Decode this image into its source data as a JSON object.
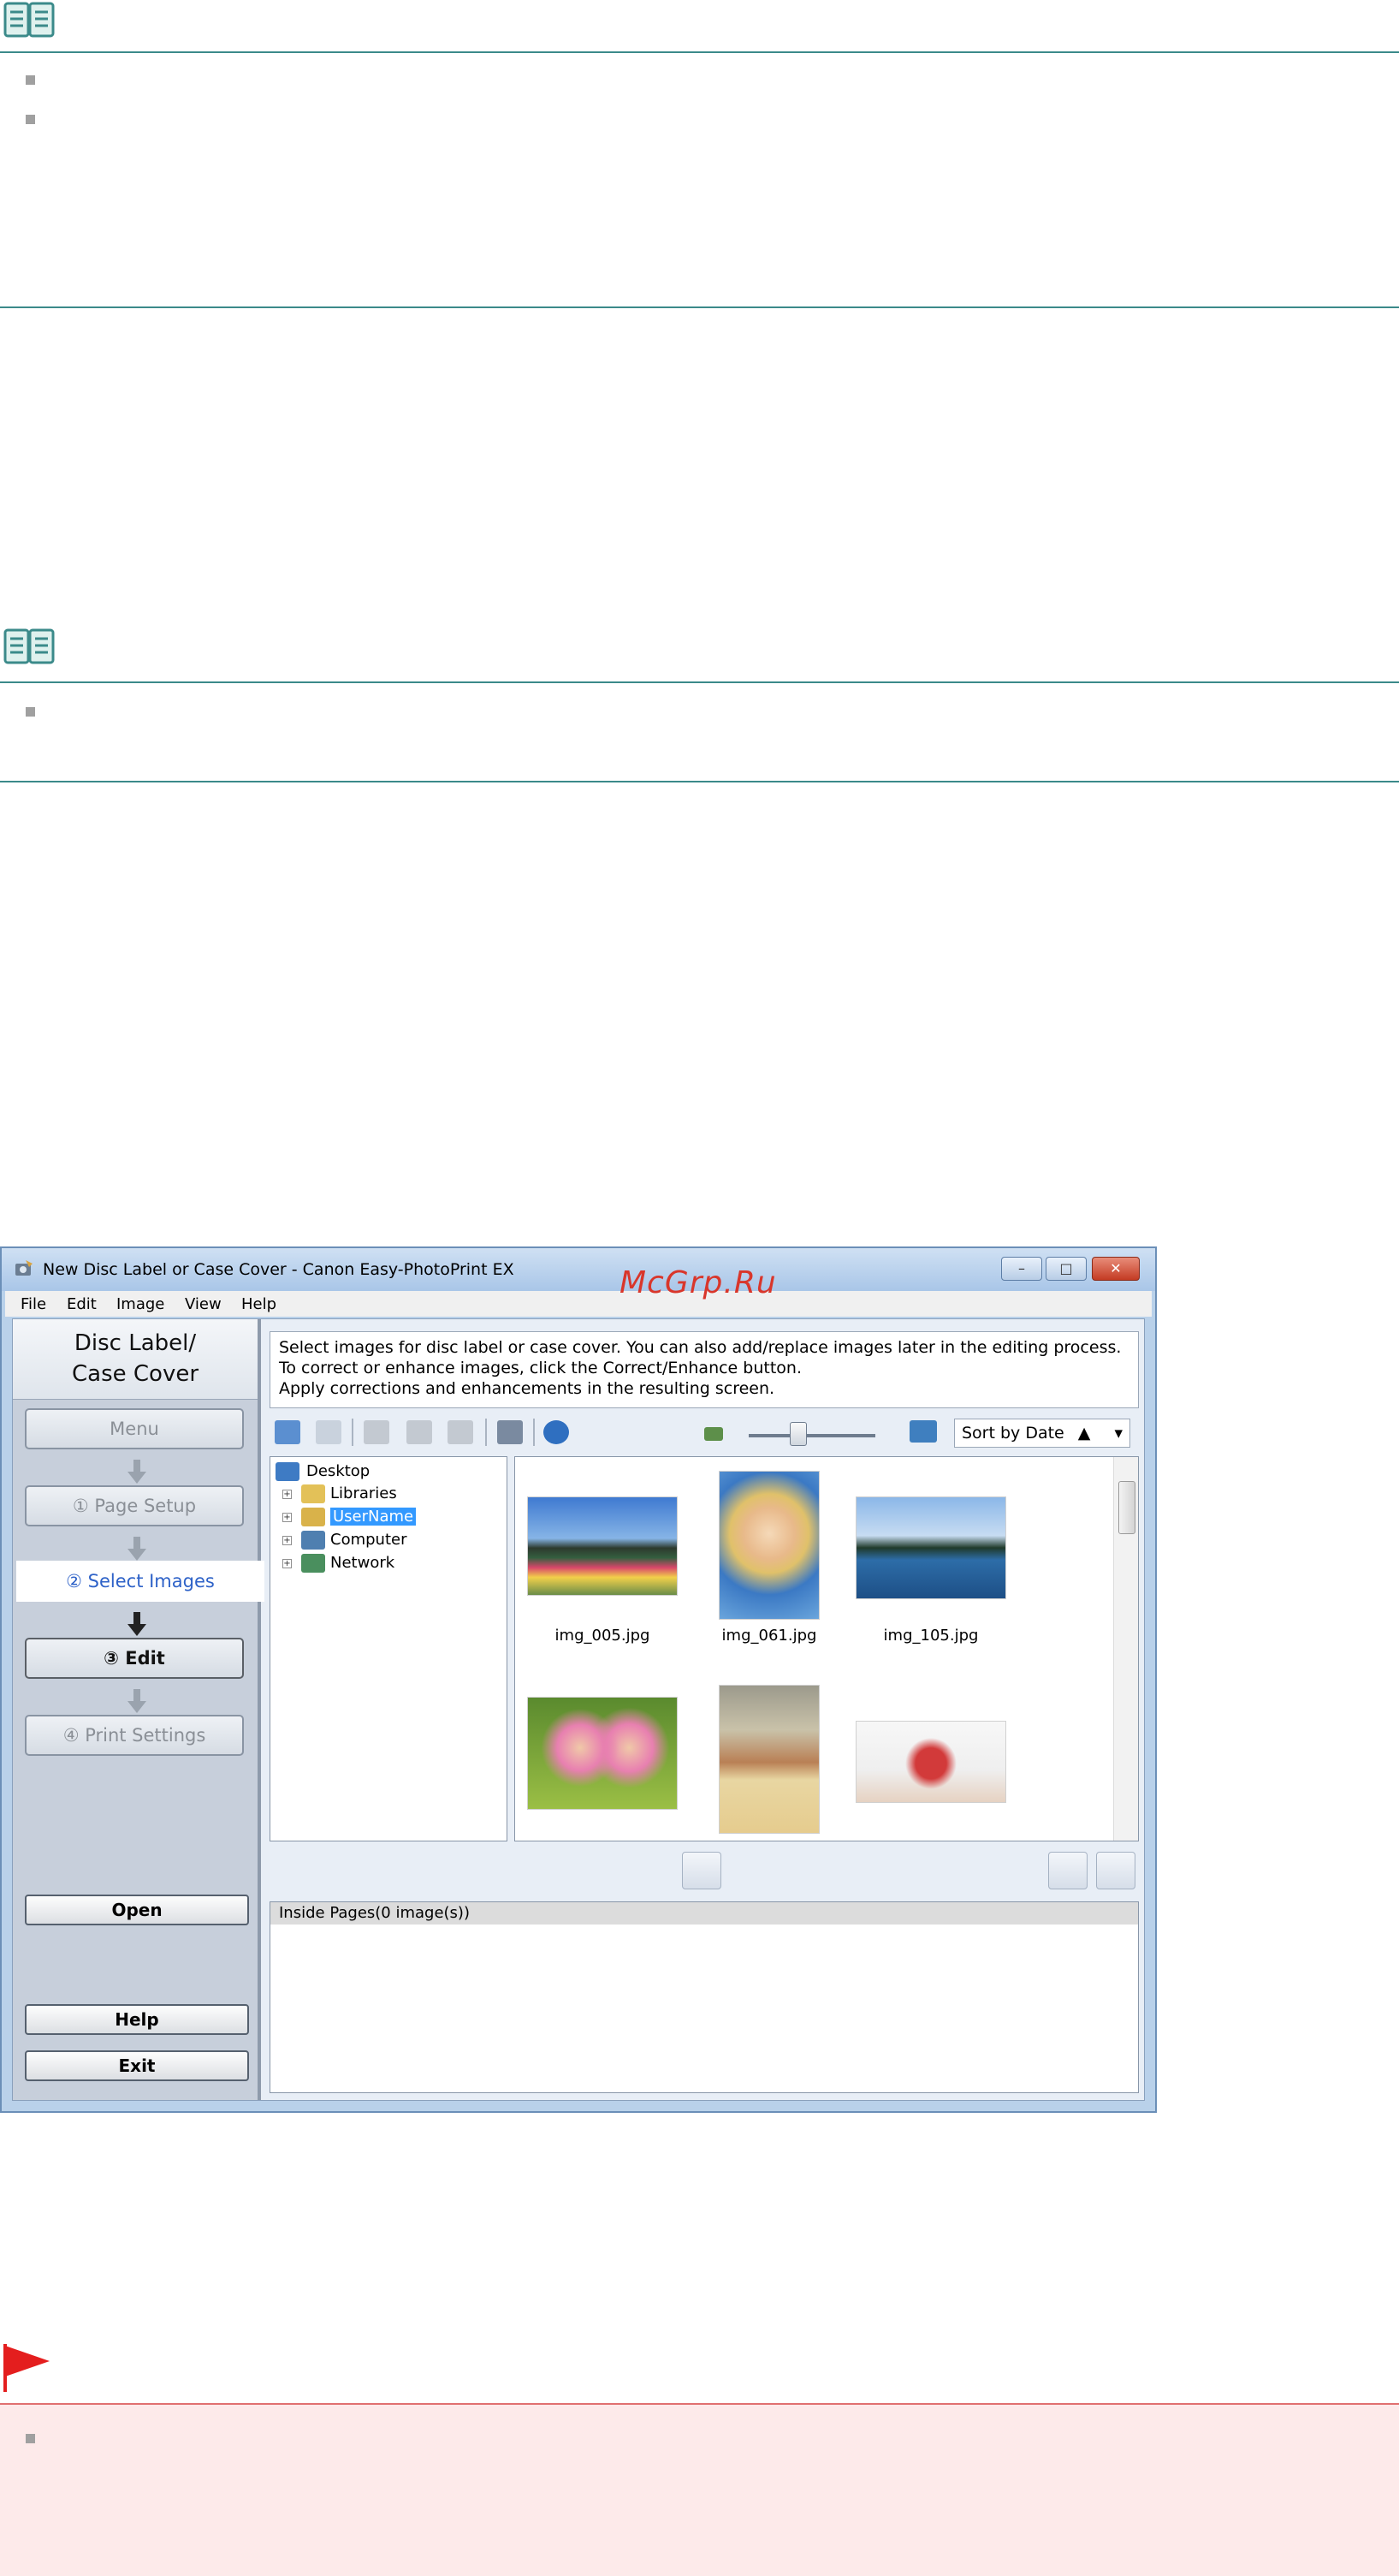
{
  "window": {
    "title": "New Disc Label or Case Cover - Canon Easy-PhotoPrint EX",
    "controls": [
      "–",
      "□",
      "✕"
    ],
    "menu": [
      "File",
      "Edit",
      "Image",
      "View",
      "Help"
    ]
  },
  "left_panel": {
    "title_line1": "Disc Label/",
    "title_line2": "Case Cover",
    "menu_btn": "Menu",
    "steps": [
      {
        "label": "①  Page Setup"
      },
      {
        "label": "②  Select Images"
      },
      {
        "label": "③  Edit"
      },
      {
        "label": "④  Print Settings"
      }
    ],
    "open_btn": "Open",
    "help_btn": "Help",
    "exit_btn": "Exit"
  },
  "instructions": [
    "Select images for disc label or case cover. You can also add/replace images later in the editing process.",
    "To correct or enhance images, click the Correct/Enhance button.",
    "Apply corrections and enhancements in the resulting screen."
  ],
  "sort": {
    "label": "Sort by Date",
    "arrow": "▲",
    "dropdown": "▾"
  },
  "tree": {
    "root": "Desktop",
    "items": [
      {
        "label": "Libraries"
      },
      {
        "label": "UserName"
      },
      {
        "label": "Computer"
      },
      {
        "label": "Network"
      }
    ]
  },
  "thumbnails": [
    {
      "label": "img_005.jpg"
    },
    {
      "label": "img_061.jpg"
    },
    {
      "label": "img_105.jpg"
    }
  ],
  "inside_pages": {
    "header": "Inside Pages(0 image(s))"
  },
  "watermark": "McGrp.Ru",
  "colors": {
    "teal_rule": "#3b8a8a",
    "important_bg": "#fdeaea",
    "flag": "#e41e1e",
    "selected_step": "#2e62c8"
  }
}
